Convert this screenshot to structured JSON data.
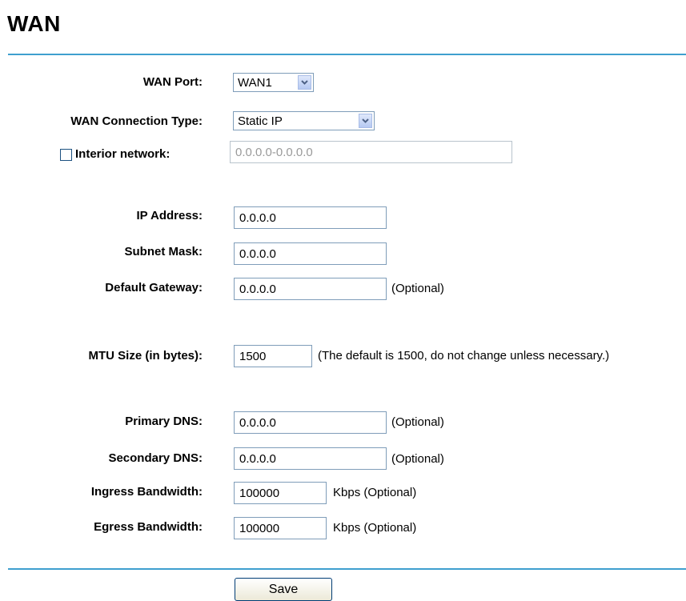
{
  "page": {
    "title": "WAN"
  },
  "form": {
    "wan_port": {
      "label": "WAN Port:",
      "value": "WAN1"
    },
    "connection_type": {
      "label": "WAN Connection Type:",
      "value": "Static IP"
    },
    "interior_network": {
      "label": "Interior network:",
      "checked": false,
      "placeholder": "0.0.0.0-0.0.0.0"
    },
    "ip_address": {
      "label": "IP Address:",
      "value": "0.0.0.0"
    },
    "subnet_mask": {
      "label": "Subnet Mask:",
      "value": "0.0.0.0"
    },
    "default_gateway": {
      "label": "Default Gateway:",
      "value": "0.0.0.0",
      "note": "(Optional)"
    },
    "mtu": {
      "label": "MTU Size (in bytes):",
      "value": "1500",
      "note": "(The default is 1500, do not change unless necessary.)"
    },
    "primary_dns": {
      "label": "Primary DNS:",
      "value": "0.0.0.0",
      "note": "(Optional)"
    },
    "secondary_dns": {
      "label": "Secondary DNS:",
      "value": "0.0.0.0",
      "note": "(Optional)"
    },
    "ingress_bandwidth": {
      "label": "Ingress Bandwidth:",
      "value": "100000",
      "note": "Kbps (Optional)"
    },
    "egress_bandwidth": {
      "label": "Egress Bandwidth:",
      "value": "100000",
      "note": "Kbps (Optional)"
    }
  },
  "actions": {
    "save_label": "Save"
  },
  "colors": {
    "rule": "#3f9fcf",
    "input_border": "#7f9db9"
  }
}
